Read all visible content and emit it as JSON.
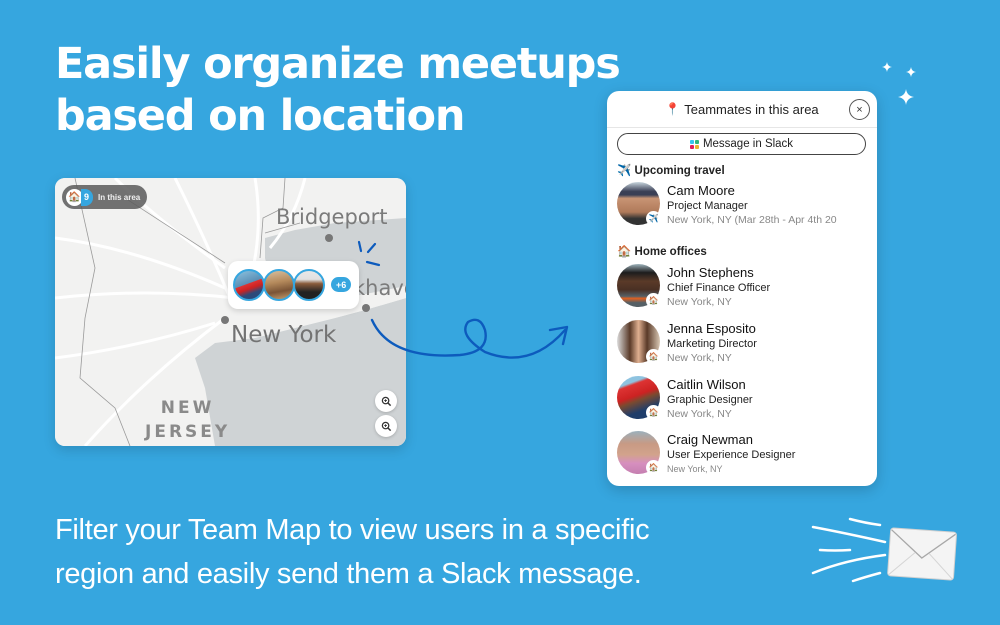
{
  "headline": {
    "line1": "Easily organize meetups",
    "line2": "based on location"
  },
  "subtext": {
    "line1": "Filter your Team Map to view users in a specific",
    "line2": "region and easily send them a Slack message."
  },
  "map": {
    "area_pill": {
      "emoji": "🏠",
      "count": "9",
      "label": "In this area"
    },
    "labels": {
      "bridgeport": "Bridgeport",
      "new_york": "New York",
      "khaven": "khave",
      "nj_line1": "NEW",
      "nj_line2": "JERSEY"
    },
    "cluster": {
      "more_count": "+6"
    },
    "zoom_in_icon": "zoom-in-icon",
    "zoom_out_icon": "zoom-out-icon"
  },
  "panel": {
    "title": "Teammates in this area",
    "pin_icon": "📍",
    "close_icon": "×",
    "slack_button": "Message in Slack",
    "sections": {
      "travel": {
        "emoji": "✈️",
        "title": "Upcoming travel"
      },
      "home": {
        "emoji": "🏠",
        "title": "Home offices"
      }
    },
    "travel_people": [
      {
        "name": "Cam Moore",
        "role": "Project Manager",
        "location": "New York, NY (Mar 28th - Apr 4th 20",
        "badge": "✈️"
      }
    ],
    "home_people": [
      {
        "name": "John Stephens",
        "role": "Chief Finance Officer",
        "location": "New York, NY",
        "badge": "🏠"
      },
      {
        "name": "Jenna Esposito",
        "role": "Marketing Director",
        "location": "New York, NY",
        "badge": "🏠"
      },
      {
        "name": "Caitlin Wilson",
        "role": "Graphic Designer",
        "location": "New York, NY",
        "badge": "🏠"
      },
      {
        "name": "Craig Newman",
        "role": "User Experience Designer",
        "location": "New York, NY",
        "badge": "🏠"
      }
    ]
  },
  "colors": {
    "background": "#36a6df",
    "accent": "#36a6df",
    "arrow": "#0d5bbd",
    "slack": [
      "#36c5f0",
      "#2eb67d",
      "#ecb22e",
      "#e01e5a"
    ]
  }
}
